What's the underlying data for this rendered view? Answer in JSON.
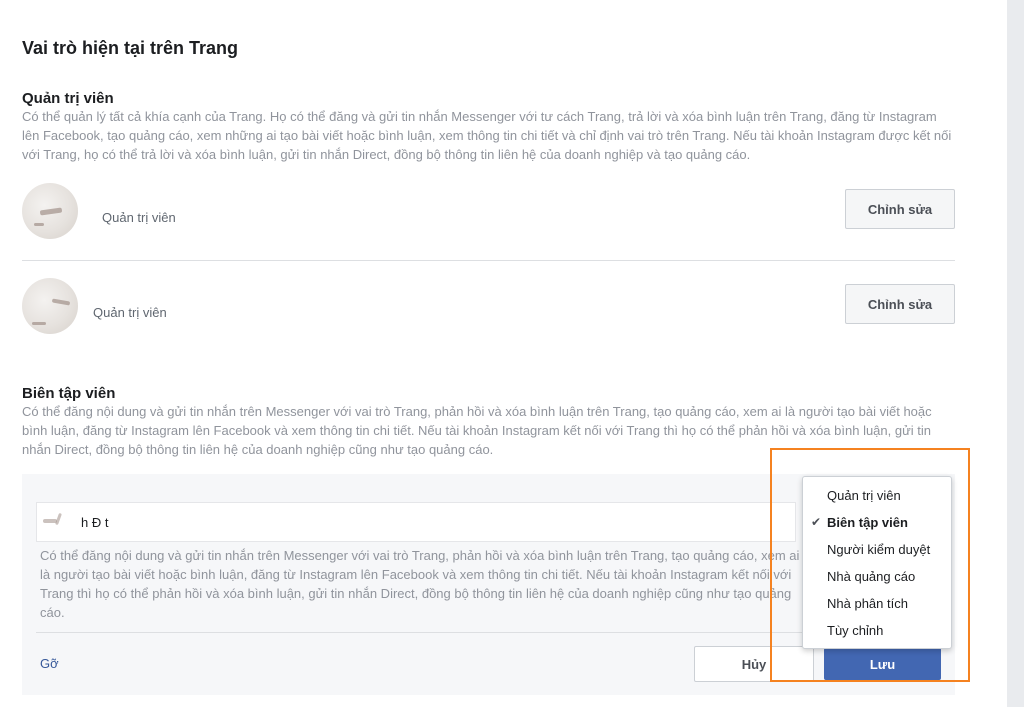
{
  "page": {
    "title": "Vai trò hiện tại trên Trang"
  },
  "admin_section": {
    "title": "Quản trị viên",
    "description": "Có thể quản lý tất cả khía cạnh của Trang. Họ có thể đăng và gửi tin nhắn Messenger với tư cách Trang, trả lời và xóa bình luận trên Trang, đăng từ Instagram lên Facebook, tạo quảng cáo, xem những ai tạo bài viết hoặc bình luận, xem thông tin chi tiết và chỉ định vai trò trên Trang. Nếu tài khoản Instagram được kết nối với Trang, họ có thể trả lời và xóa bình luận, gửi tin nhắn Direct, đồng bộ thông tin liên hệ của doanh nghiệp và tạo quảng cáo.",
    "people": [
      {
        "role": "Quản trị viên",
        "edit_label": "Chỉnh sửa"
      },
      {
        "role": "Quản trị viên",
        "edit_label": "Chỉnh sửa"
      }
    ]
  },
  "editor_section": {
    "title": "Biên tập viên",
    "description": "Có thể đăng nội dung và gửi tin nhắn trên Messenger với vai trò Trang, phản hồi và xóa bình luận trên Trang, tạo quảng cáo, xem ai là người tạo bài viết hoặc bình luận, đăng từ Instagram lên Facebook và xem thông tin chi tiết. Nếu tài khoản Instagram kết nối với Trang thì họ có thể phản hồi và xóa bình luận, gửi tin nhắn Direct, đồng bộ thông tin liên hệ của doanh nghiệp cũng như tạo quảng cáo."
  },
  "edit_panel": {
    "person_name_partial": "h       Đ      t",
    "role_description": "Có thể đăng nội dung và gửi tin nhắn trên Messenger với vai trò Trang, phản hồi và xóa bình luận trên Trang, tạo quảng cáo, xem ai là người tạo bài viết hoặc bình luận, đăng từ Instagram lên Facebook và xem thông tin chi tiết. Nếu tài khoản Instagram kết nối với Trang thì họ có thể phản hồi và xóa bình luận, gửi tin nhắn Direct, đồng bộ thông tin liên hệ của doanh nghiệp cũng như tạo quảng cáo.",
    "remove_label": "Gỡ",
    "cancel_label": "Hủy",
    "save_label": "Lưu"
  },
  "role_dropdown": {
    "selected": "Biên tập viên",
    "items": [
      "Quản trị viên",
      "Biên tập viên",
      "Người kiểm duyệt",
      "Nhà quảng cáo",
      "Nhà phân tích",
      "Tùy chỉnh"
    ],
    "check_glyph": "✔"
  },
  "colors": {
    "highlight": "#f58220",
    "primary_button": "#4267b2",
    "link": "#365899"
  }
}
